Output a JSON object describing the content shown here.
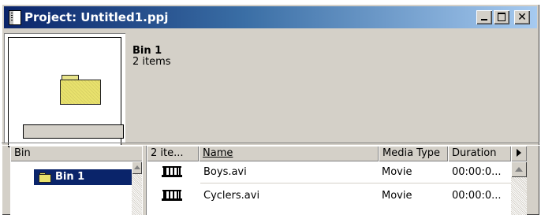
{
  "window": {
    "title": "Project: Untitled1.ppj",
    "close_glyph": "✕",
    "icons": [
      "project-document-icon",
      "minimize-icon",
      "maximize-icon",
      "close-icon"
    ]
  },
  "preview": {
    "bin_name": "Bin 1",
    "item_count": "2 items",
    "icon": "folder-icon"
  },
  "bin_pane": {
    "header": "Bin",
    "items": [
      {
        "label": "Bin 1",
        "selected": true,
        "icon": "folder-icon"
      }
    ]
  },
  "list_pane": {
    "columns": {
      "count": "2 ite...",
      "name": "Name",
      "media_type": "Media Type",
      "duration": "Duration"
    },
    "rows": [
      {
        "icon": "film-clip-icon",
        "name": "Boys.avi",
        "media_type": "Movie",
        "duration": "00:00:0..."
      },
      {
        "icon": "film-clip-icon",
        "name": "Cyclers.avi",
        "media_type": "Movie",
        "duration": "00:00:0..."
      }
    ]
  },
  "colors": {
    "title_bar_start": "#0a246a",
    "title_bar_end": "#a6caf0",
    "selection": "#0a246a",
    "face": "#d4d0c8",
    "folder": "#e9e26d"
  }
}
